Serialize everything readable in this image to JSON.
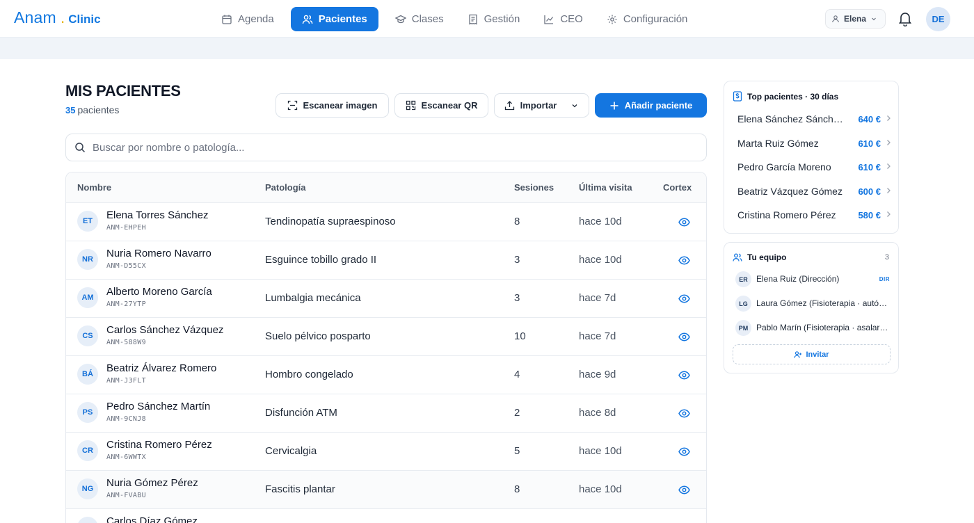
{
  "brand": {
    "name": "Anam",
    "dot": ".",
    "sub": "Clinic"
  },
  "nav": [
    {
      "label": "Agenda",
      "icon": "calendar-icon",
      "active": false
    },
    {
      "label": "Pacientes",
      "icon": "users-icon",
      "active": true
    },
    {
      "label": "Clases",
      "icon": "graduation-cap-icon",
      "active": false
    },
    {
      "label": "Gestión",
      "icon": "receipt-icon",
      "active": false
    },
    {
      "label": "CEO",
      "icon": "line-chart-icon",
      "active": false
    },
    {
      "label": "Configuración",
      "icon": "gear-icon",
      "active": false
    }
  ],
  "user": {
    "name": "Elena",
    "initials": "DE"
  },
  "page": {
    "title": "MIS PACIENTES",
    "count_number": "35",
    "count_label": "pacientes"
  },
  "actions": {
    "scan_image": "Escanear imagen",
    "scan_qr": "Escanear QR",
    "import": "Importar",
    "add_patient": "Añadir paciente"
  },
  "search": {
    "placeholder": "Buscar por nombre o patología..."
  },
  "table": {
    "headers": {
      "name": "Nombre",
      "pathology": "Patología",
      "sessions": "Sesiones",
      "last_visit": "Última visita",
      "cortex": "Cortex"
    },
    "rows": [
      {
        "initials": "ET",
        "name": "Elena Torres Sánchez",
        "code": "ANM-EHPEH",
        "pathology": "Tendinopatía supraespinoso",
        "sessions": "8",
        "last_visit": "hace 10d"
      },
      {
        "initials": "NR",
        "name": "Nuria Romero Navarro",
        "code": "ANM-D55CX",
        "pathology": "Esguince tobillo grado II",
        "sessions": "3",
        "last_visit": "hace 10d"
      },
      {
        "initials": "AM",
        "name": "Alberto Moreno García",
        "code": "ANM-27YTP",
        "pathology": "Lumbalgia mecánica",
        "sessions": "3",
        "last_visit": "hace 7d"
      },
      {
        "initials": "CS",
        "name": "Carlos Sánchez Vázquez",
        "code": "ANM-588W9",
        "pathology": "Suelo pélvico posparto",
        "sessions": "10",
        "last_visit": "hace 7d"
      },
      {
        "initials": "BÁ",
        "name": "Beatriz Álvarez Romero",
        "code": "ANM-J3FLT",
        "pathology": "Hombro congelado",
        "sessions": "4",
        "last_visit": "hace 9d"
      },
      {
        "initials": "PS",
        "name": "Pedro Sánchez Martín",
        "code": "ANM-9CNJ8",
        "pathology": "Disfunción ATM",
        "sessions": "2",
        "last_visit": "hace 8d"
      },
      {
        "initials": "CR",
        "name": "Cristina Romero Pérez",
        "code": "ANM-6WWTX",
        "pathology": "Cervicalgia",
        "sessions": "5",
        "last_visit": "hace 10d"
      },
      {
        "initials": "NG",
        "name": "Nuria Gómez Pérez",
        "code": "ANM-FVABU",
        "pathology": "Fascitis plantar",
        "sessions": "8",
        "last_visit": "hace 10d"
      },
      {
        "initials": "CD",
        "name": "Carlos Díaz Gómez",
        "code": "",
        "pathology": "",
        "sessions": "",
        "last_visit": ""
      }
    ]
  },
  "top_patients": {
    "title": "Top pacientes · 30 días",
    "items": [
      {
        "name": "Elena Sánchez Sánchez",
        "value": "640 €"
      },
      {
        "name": "Marta Ruiz Gómez",
        "value": "610 €"
      },
      {
        "name": "Pedro García Moreno",
        "value": "610 €"
      },
      {
        "name": "Beatriz Vázquez Gómez",
        "value": "600 €"
      },
      {
        "name": "Cristina Romero Pérez",
        "value": "580 €"
      }
    ]
  },
  "team": {
    "title": "Tu equipo",
    "count": "3",
    "members": [
      {
        "initials": "ER",
        "name": "Elena Ruiz (Dirección)",
        "badge": "DIR"
      },
      {
        "initials": "LG",
        "name": "Laura Gómez (Fisioterapia · autónoma)",
        "badge": ""
      },
      {
        "initials": "PM",
        "name": "Pablo Marín (Fisioterapia · asalariado)",
        "badge": ""
      }
    ],
    "invite": "Invitar"
  },
  "colors": {
    "accent": "#1476e0",
    "brand_dot": "#e6b400"
  }
}
